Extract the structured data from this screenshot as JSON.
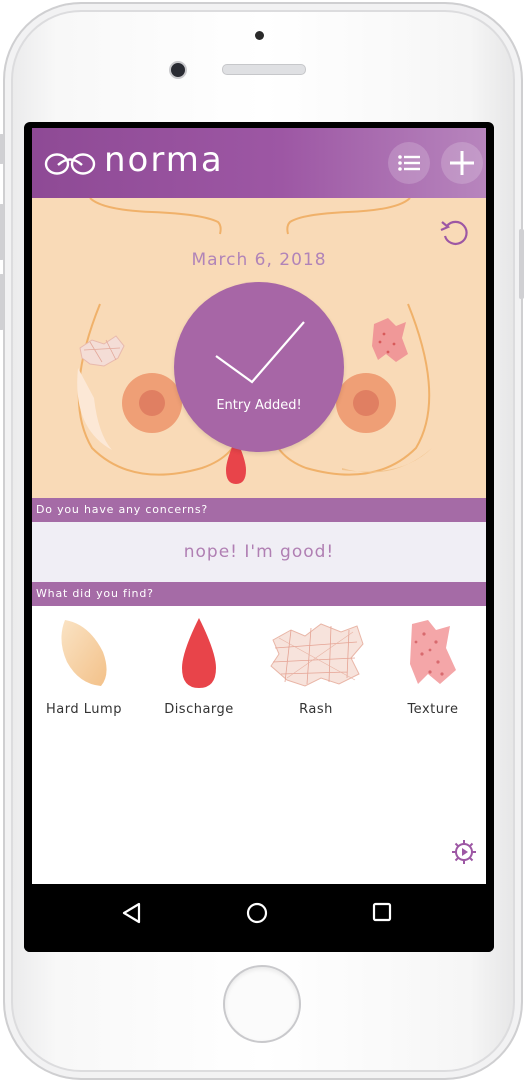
{
  "app": {
    "brand": "norma"
  },
  "hero": {
    "date": "March 6, 2018",
    "toast": "Entry Added!"
  },
  "concerns": {
    "header": "Do you have any concerns?",
    "answer": "nope! I'm good!"
  },
  "findings": {
    "header": "What did you find?",
    "items": [
      {
        "label": "Hard Lump",
        "icon": "hard-lump-icon"
      },
      {
        "label": "Discharge",
        "icon": "discharge-icon"
      },
      {
        "label": "Rash",
        "icon": "rash-icon"
      },
      {
        "label": "Texture",
        "icon": "texture-icon"
      }
    ]
  },
  "colors": {
    "primary": "#9d57a4",
    "hero_bg": "#f9dab7",
    "toast": "#a766a6",
    "discharge": "#e8444a",
    "answer_bg": "#f0eef5"
  }
}
